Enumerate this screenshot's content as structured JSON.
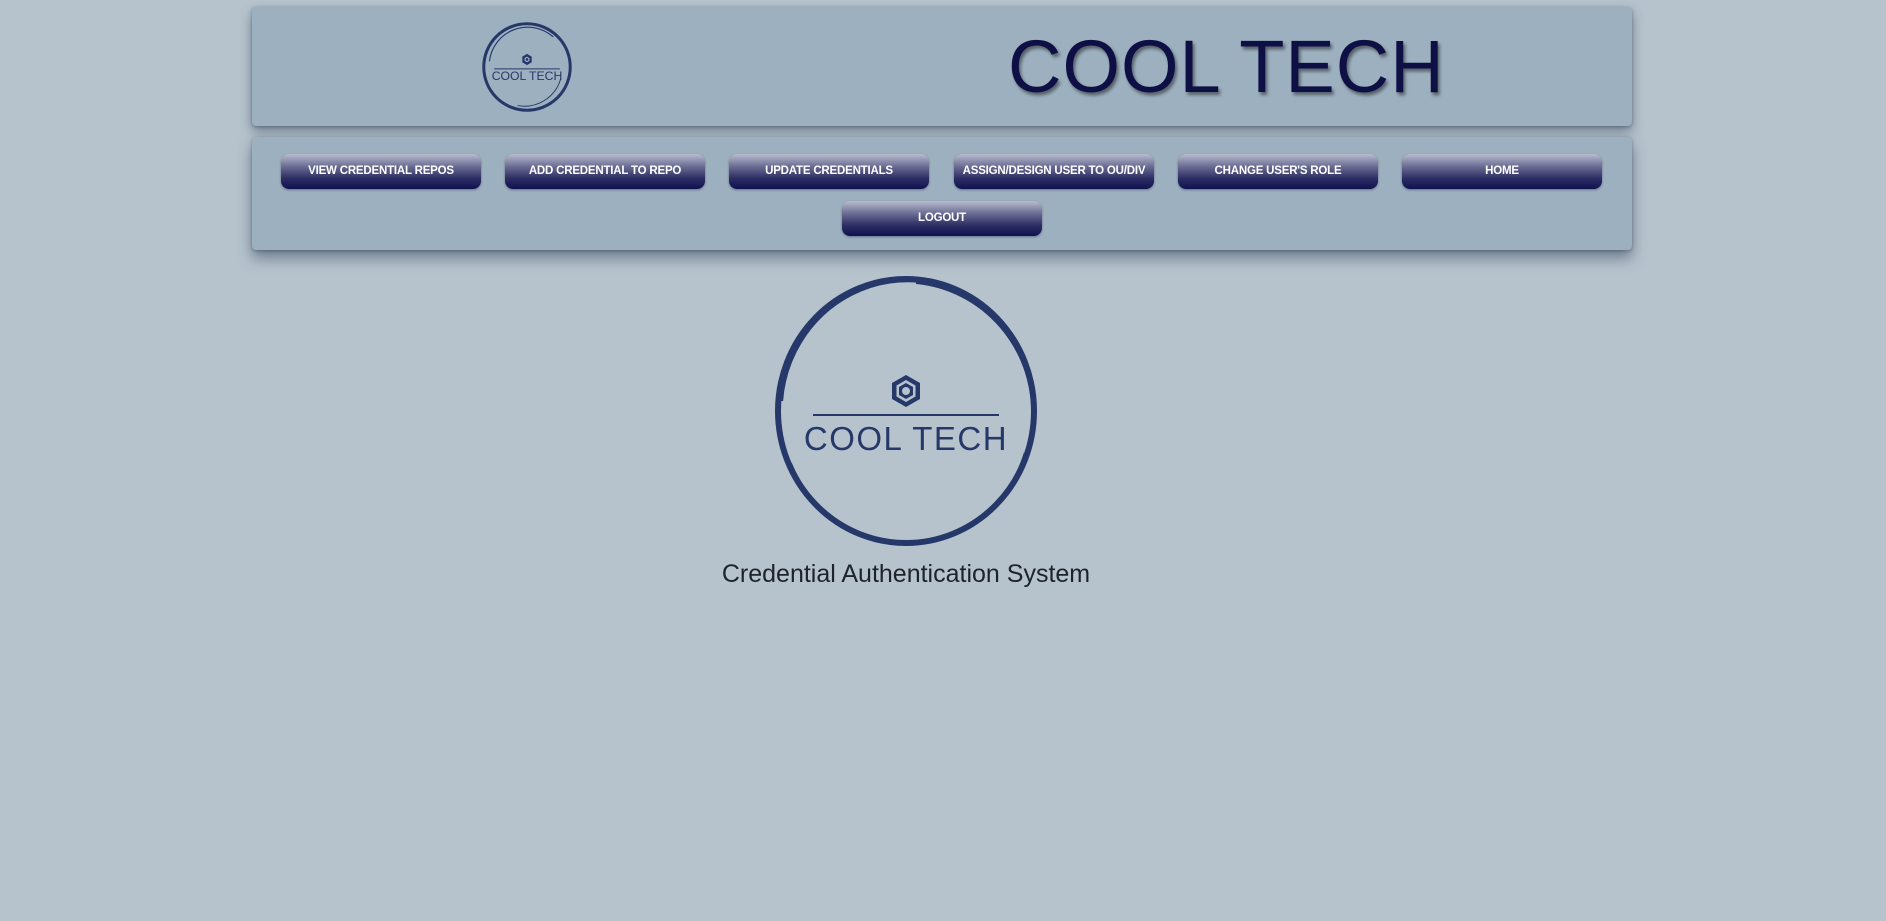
{
  "header": {
    "logo_text": "COOL TECH",
    "title": "COOL TECH"
  },
  "nav": {
    "buttons": [
      {
        "label": "VIEW CREDENTIAL REPOS"
      },
      {
        "label": "ADD CREDENTIAL TO REPO"
      },
      {
        "label": "UPDATE CREDENTIALS"
      },
      {
        "label": "ASSIGN/DESIGN USER TO OU/DIV"
      },
      {
        "label": "CHANGE USER'S ROLE"
      },
      {
        "label": "HOME"
      },
      {
        "label": "LOGOUT"
      }
    ]
  },
  "main": {
    "logo_text": "COOL TECH",
    "subtitle": "Credential Authentication System"
  },
  "colors": {
    "background": "#b6c3cd",
    "panel": "#9cb0bf",
    "brand_navy": "#0e0f45",
    "logo_blue": "#253869"
  }
}
